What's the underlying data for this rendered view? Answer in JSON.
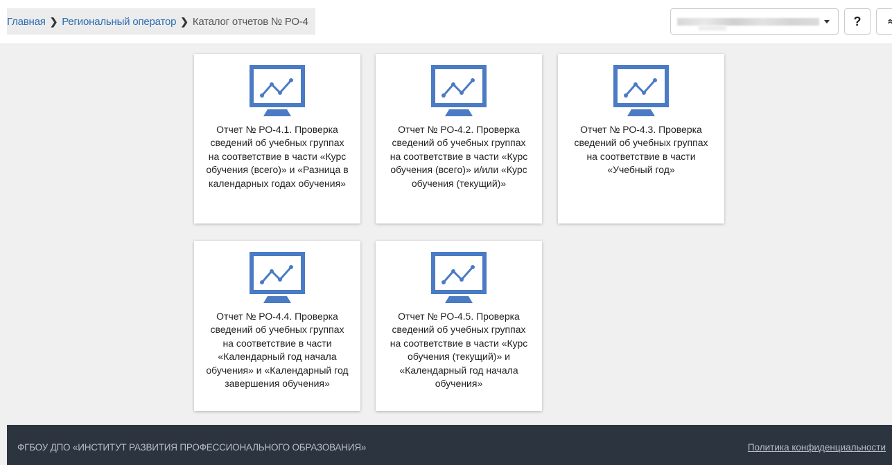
{
  "breadcrumb": {
    "home": "Главная",
    "regional": "Региональный оператор",
    "current": "Каталог отчетов № РО-4"
  },
  "header": {
    "help_label": "?",
    "collapse_label": "»"
  },
  "cards": [
    {
      "title": "Отчет № РО-4.1. Проверка сведений об учебных группах на соответствие в части «Курс обучения (всего)» и «Разница в календарных годах обучения»"
    },
    {
      "title": "Отчет № РО-4.2. Проверка сведений об учебных группах на соответствие в части «Курс обучения (всего)» и/или «Курс обучения (текущий)»"
    },
    {
      "title": "Отчет № РО-4.3. Проверка сведений об учебных группах на соответствие в части «Учебный год»"
    },
    {
      "title": "Отчет № РО-4.4. Проверка сведений об учебных группах на соответствие в части «Календарный год начала обучения» и «Календарный год завершения обучения»"
    },
    {
      "title": "Отчет № РО-4.5. Проверка сведений об учебных группах на соответствие в части «Курс обучения (текущий)» и «Календарный год начала обучения»"
    }
  ],
  "icons": {
    "report_icon": "monitor-chart-icon",
    "breadcrumb_separator": "chevron-right-icon",
    "select_caret": "caret-down-icon"
  },
  "colors": {
    "accent": "#4a7bc4",
    "link": "#2a6db3",
    "footer_bg": "#2c3440"
  },
  "footer": {
    "org": "ФГБОУ ДПО «ИНСТИТУТ РАЗВИТИЯ ПРОФЕССИОНАЛЬНОГО ОБРАЗОВАНИЯ»",
    "policy": "Политика конфиденциальности"
  }
}
